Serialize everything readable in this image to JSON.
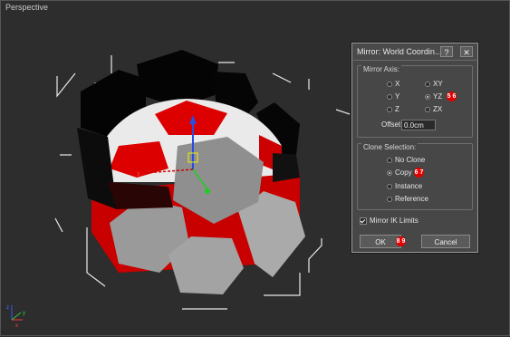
{
  "viewport": {
    "label": "Perspective"
  },
  "dialog": {
    "title": "Mirror: World Coordin...",
    "help_btn": "?",
    "close_btn": "✕",
    "mirror_axis": {
      "label": "Mirror Axis:",
      "options": [
        "X",
        "Y",
        "Z",
        "XY",
        "YZ",
        "ZX"
      ],
      "selected": "YZ"
    },
    "offset": {
      "label": "Offset:",
      "value": "0.0cm"
    },
    "clone_selection": {
      "label": "Clone Selection:",
      "options": [
        "No Clone",
        "Copy",
        "Instance",
        "Reference"
      ],
      "selected": "Copy"
    },
    "mirror_ik": {
      "label": "Mirror IK Limits",
      "checked": true
    },
    "ok_label": "OK",
    "cancel_label": "Cancel",
    "badges": {
      "yz": "5 6",
      "copy": "6 7",
      "ok": "8 9"
    }
  },
  "gizmo": {
    "x_label": "x",
    "axes": [
      "x",
      "y",
      "z"
    ]
  },
  "colors": {
    "red": "#dd0000",
    "white": "#eeeeee",
    "gray": "#999999",
    "black": "#050505"
  }
}
